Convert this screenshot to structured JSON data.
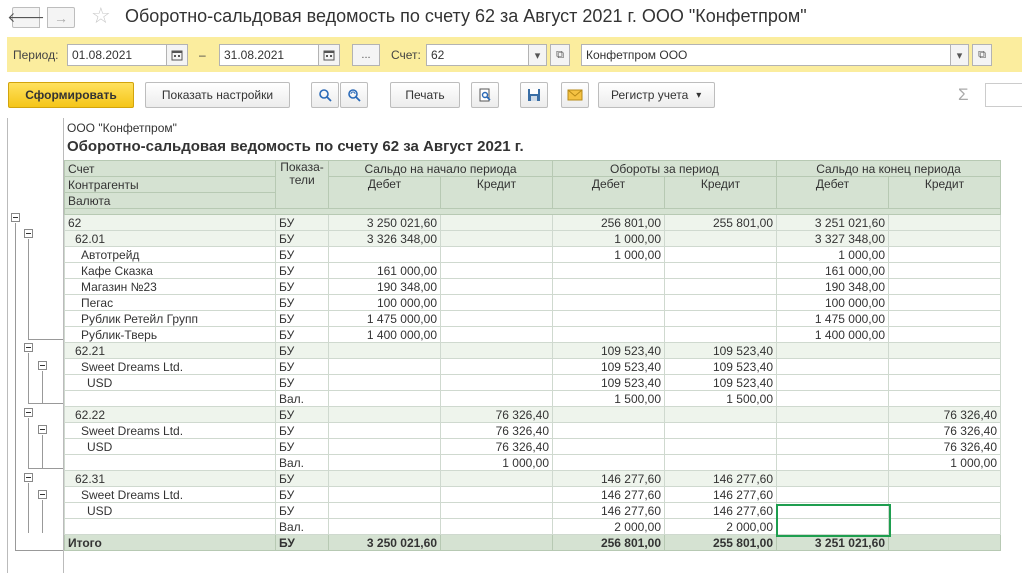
{
  "window": {
    "title": "Оборотно-сальдовая ведомость по счету 62 за Август 2021 г. ООО \"Конфетпром\"",
    "back_glyph": "🡐",
    "fwd_glyph": "→",
    "star_glyph": "☆"
  },
  "params": {
    "period_label": "Период:",
    "date_from": "01.08.2021",
    "date_to": "31.08.2021",
    "dash": "–",
    "dots": "...",
    "account_label": "Счет:",
    "account_value": "62",
    "org_value": "Конфетпром ООО",
    "calendar_icon": "calendar-icon",
    "dropdown_glyph": "▾",
    "open_glyph": "⧉"
  },
  "toolbar": {
    "generate_label": "Сформировать",
    "settings_label": "Показать настройки",
    "print_label": "Печать",
    "register_label": "Регистр учета",
    "dropdown_glyph": "▾",
    "sigma_glyph": "Σ"
  },
  "report": {
    "org": "ООО \"Конфетпром\"",
    "heading": "Оборотно-сальдовая ведомость по счету 62 за Август 2021 г.",
    "headers": {
      "account": "Счет",
      "contractors": "Контрагенты",
      "currency": "Валюта",
      "indicators": "Показа-\nтели",
      "opening": "Сальдо на начало периода",
      "turnover": "Обороты за период",
      "closing": "Сальдо на конец периода",
      "debit": "Дебет",
      "credit": "Кредит"
    },
    "rows": [
      {
        "level": 0,
        "name": "62",
        "ind": "БУ",
        "od": "3 250 021,60",
        "oc": "",
        "td": "256 801,00",
        "tc": "255 801,00",
        "cd": "3 251 021,60",
        "cc": ""
      },
      {
        "level": 1,
        "name": "62.01",
        "ind": "БУ",
        "od": "3 326 348,00",
        "oc": "",
        "td": "1 000,00",
        "tc": "",
        "cd": "3 327 348,00",
        "cc": ""
      },
      {
        "level": 2,
        "name": "Автотрейд",
        "ind": "БУ",
        "od": "",
        "oc": "",
        "td": "1 000,00",
        "tc": "",
        "cd": "1 000,00",
        "cc": ""
      },
      {
        "level": 2,
        "name": "Кафе Сказка",
        "ind": "БУ",
        "od": "161 000,00",
        "oc": "",
        "td": "",
        "tc": "",
        "cd": "161 000,00",
        "cc": ""
      },
      {
        "level": 2,
        "name": "Магазин №23",
        "ind": "БУ",
        "od": "190 348,00",
        "oc": "",
        "td": "",
        "tc": "",
        "cd": "190 348,00",
        "cc": ""
      },
      {
        "level": 2,
        "name": "Пегас",
        "ind": "БУ",
        "od": "100 000,00",
        "oc": "",
        "td": "",
        "tc": "",
        "cd": "100 000,00",
        "cc": ""
      },
      {
        "level": 2,
        "name": "Рублик Ретейл Групп",
        "ind": "БУ",
        "od": "1 475 000,00",
        "oc": "",
        "td": "",
        "tc": "",
        "cd": "1 475 000,00",
        "cc": ""
      },
      {
        "level": 2,
        "name": "Рублик-Тверь",
        "ind": "БУ",
        "od": "1 400 000,00",
        "oc": "",
        "td": "",
        "tc": "",
        "cd": "1 400 000,00",
        "cc": ""
      },
      {
        "level": 1,
        "name": "62.21",
        "ind": "БУ",
        "od": "",
        "oc": "",
        "td": "109 523,40",
        "tc": "109 523,40",
        "cd": "",
        "cc": ""
      },
      {
        "level": 2,
        "name": "Sweet Dreams Ltd.",
        "ind": "БУ",
        "od": "",
        "oc": "",
        "td": "109 523,40",
        "tc": "109 523,40",
        "cd": "",
        "cc": ""
      },
      {
        "level": 3,
        "name": "USD",
        "ind": "БУ",
        "od": "",
        "oc": "",
        "td": "109 523,40",
        "tc": "109 523,40",
        "cd": "",
        "cc": ""
      },
      {
        "level": 3,
        "name": "",
        "ind": "Вал.",
        "od": "",
        "oc": "",
        "td": "1 500,00",
        "tc": "1 500,00",
        "cd": "",
        "cc": ""
      },
      {
        "level": 1,
        "name": "62.22",
        "ind": "БУ",
        "od": "",
        "oc": "76 326,40",
        "td": "",
        "tc": "",
        "cd": "",
        "cc": "76 326,40"
      },
      {
        "level": 2,
        "name": "Sweet Dreams Ltd.",
        "ind": "БУ",
        "od": "",
        "oc": "76 326,40",
        "td": "",
        "tc": "",
        "cd": "",
        "cc": "76 326,40"
      },
      {
        "level": 3,
        "name": "USD",
        "ind": "БУ",
        "od": "",
        "oc": "76 326,40",
        "td": "",
        "tc": "",
        "cd": "",
        "cc": "76 326,40"
      },
      {
        "level": 3,
        "name": "",
        "ind": "Вал.",
        "od": "",
        "oc": "1 000,00",
        "td": "",
        "tc": "",
        "cd": "",
        "cc": "1 000,00"
      },
      {
        "level": 1,
        "name": "62.31",
        "ind": "БУ",
        "od": "",
        "oc": "",
        "td": "146 277,60",
        "tc": "146 277,60",
        "cd": "",
        "cc": ""
      },
      {
        "level": 2,
        "name": "Sweet Dreams Ltd.",
        "ind": "БУ",
        "od": "",
        "oc": "",
        "td": "146 277,60",
        "tc": "146 277,60",
        "cd": "",
        "cc": ""
      },
      {
        "level": 3,
        "name": "USD",
        "ind": "БУ",
        "od": "",
        "oc": "",
        "td": "146 277,60",
        "tc": "146 277,60",
        "cd": "",
        "cc": ""
      },
      {
        "level": 3,
        "name": "",
        "ind": "Вал.",
        "od": "",
        "oc": "",
        "td": "2 000,00",
        "tc": "2 000,00",
        "cd": "",
        "cc": ""
      }
    ],
    "total": {
      "name": "Итого",
      "ind": "БУ",
      "od": "3 250 021,60",
      "oc": "",
      "td": "256 801,00",
      "tc": "255 801,00",
      "cd": "3 251 021,60",
      "cc": ""
    }
  },
  "colors": {
    "params_bg": "#fbed9e",
    "primary_button": "#f5c518",
    "header_bg": "#d5e2d2",
    "group_row_bg": "#eef4ec",
    "selection": "#1e9e4f"
  }
}
